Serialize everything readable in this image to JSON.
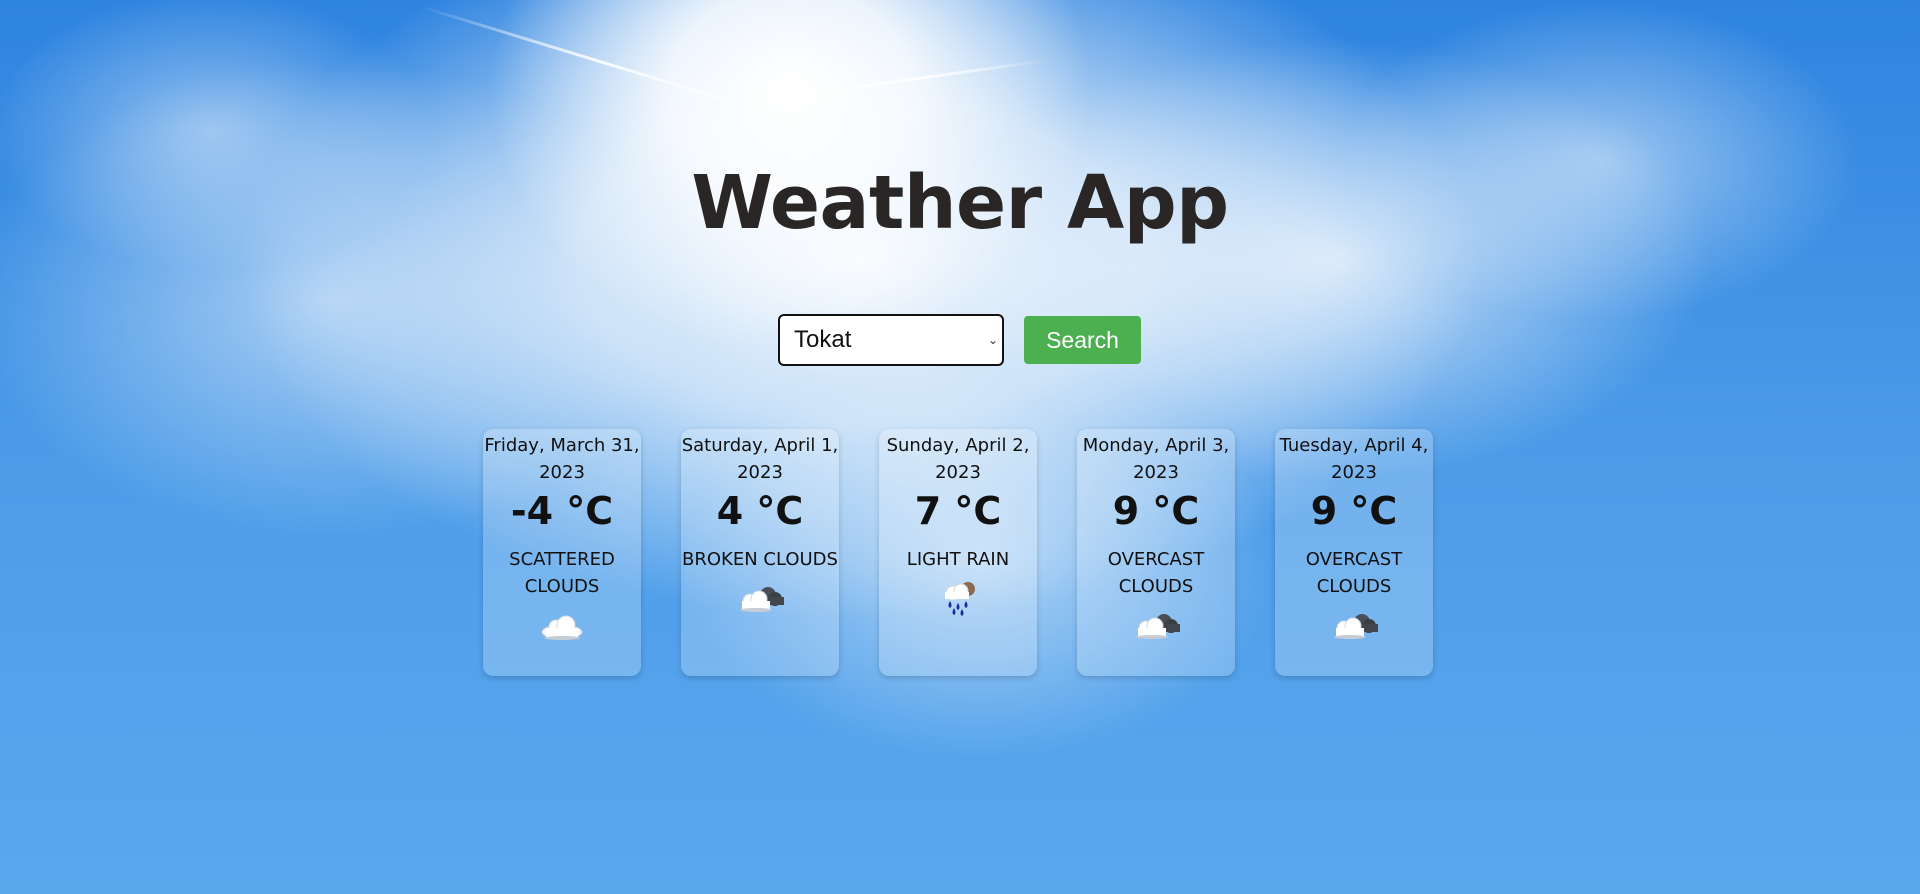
{
  "app": {
    "title": "Weather App"
  },
  "search": {
    "selected_city": "Tokat",
    "button_label": "Search"
  },
  "colors": {
    "search_button": "#4caf50",
    "title_text": "#2a2626"
  },
  "forecast": [
    {
      "date": "Friday, March 31, 2023",
      "temp": "-4 °C",
      "description": "scattered clouds",
      "icon": "cloud-icon"
    },
    {
      "date": "Saturday, April 1, 2023",
      "temp": "4 °C",
      "description": "broken clouds",
      "icon": "broken-clouds-icon"
    },
    {
      "date": "Sunday, April 2, 2023",
      "temp": "7 °C",
      "description": "light rain",
      "icon": "rain-icon"
    },
    {
      "date": "Monday, April 3, 2023",
      "temp": "9 °C",
      "description": "overcast clouds",
      "icon": "broken-clouds-icon"
    },
    {
      "date": "Tuesday, April 4, 2023",
      "temp": "9 °C",
      "description": "overcast clouds",
      "icon": "broken-clouds-icon"
    }
  ]
}
